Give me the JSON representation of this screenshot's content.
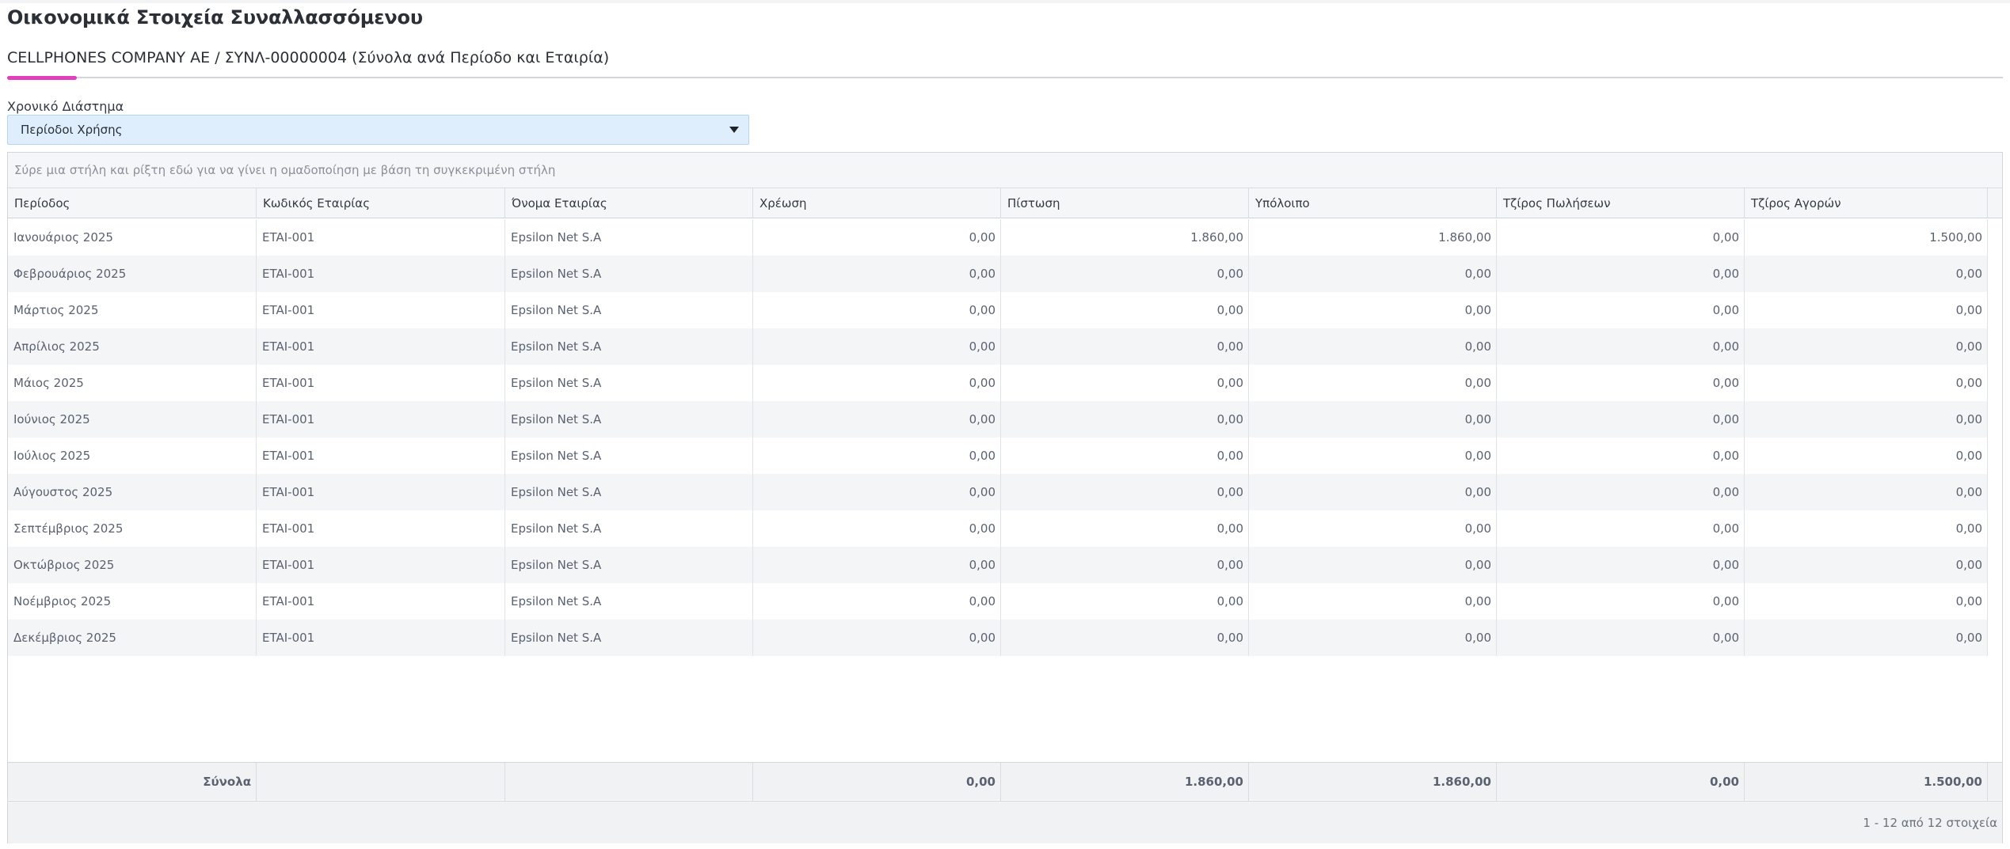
{
  "page": {
    "title": "Οικονομικά Στοιχεία Συναλλασσόμενου",
    "subtitle": "CELLPHONES COMPANY AE / ΣΥΝΛ-00000004 (Σύνολα ανά Περίοδο και Εταιρία)"
  },
  "filter": {
    "label": "Χρονικό Διάστημα",
    "selected": "Περίοδοι Χρήσης"
  },
  "grid": {
    "group_panel_text": "Σύρε μια στήλη και ρίξτη εδώ για να γίνει η ομαδοποίηση με βάση τη συγκεκριμένη στήλη",
    "columns": [
      "Περίοδος",
      "Κωδικός Εταιρίας",
      "Όνομα Εταιρίας",
      "Χρέωση",
      "Πίστωση",
      "Υπόλοιπο",
      "Τζίρος Πωλήσεων",
      "Τζίρος Αγορών"
    ],
    "rows": [
      [
        "Ιανουάριος 2025",
        "ETAI-001",
        "Epsilon Net S.A",
        "0,00",
        "1.860,00",
        "1.860,00",
        "0,00",
        "1.500,00"
      ],
      [
        "Φεβρουάριος 2025",
        "ETAI-001",
        "Epsilon Net S.A",
        "0,00",
        "0,00",
        "0,00",
        "0,00",
        "0,00"
      ],
      [
        "Μάρτιος 2025",
        "ETAI-001",
        "Epsilon Net S.A",
        "0,00",
        "0,00",
        "0,00",
        "0,00",
        "0,00"
      ],
      [
        "Απρίλιος 2025",
        "ETAI-001",
        "Epsilon Net S.A",
        "0,00",
        "0,00",
        "0,00",
        "0,00",
        "0,00"
      ],
      [
        "Μάιος 2025",
        "ETAI-001",
        "Epsilon Net S.A",
        "0,00",
        "0,00",
        "0,00",
        "0,00",
        "0,00"
      ],
      [
        "Ιούνιος 2025",
        "ETAI-001",
        "Epsilon Net S.A",
        "0,00",
        "0,00",
        "0,00",
        "0,00",
        "0,00"
      ],
      [
        "Ιούλιος 2025",
        "ETAI-001",
        "Epsilon Net S.A",
        "0,00",
        "0,00",
        "0,00",
        "0,00",
        "0,00"
      ],
      [
        "Αύγουστος 2025",
        "ETAI-001",
        "Epsilon Net S.A",
        "0,00",
        "0,00",
        "0,00",
        "0,00",
        "0,00"
      ],
      [
        "Σεπτέμβριος 2025",
        "ETAI-001",
        "Epsilon Net S.A",
        "0,00",
        "0,00",
        "0,00",
        "0,00",
        "0,00"
      ],
      [
        "Οκτώβριος 2025",
        "ETAI-001",
        "Epsilon Net S.A",
        "0,00",
        "0,00",
        "0,00",
        "0,00",
        "0,00"
      ],
      [
        "Νοέμβριος 2025",
        "ETAI-001",
        "Epsilon Net S.A",
        "0,00",
        "0,00",
        "0,00",
        "0,00",
        "0,00"
      ],
      [
        "Δεκέμβριος 2025",
        "ETAI-001",
        "Epsilon Net S.A",
        "0,00",
        "0,00",
        "0,00",
        "0,00",
        "0,00"
      ]
    ],
    "totals": [
      "Σύνολα",
      "",
      "",
      "0,00",
      "1.860,00",
      "1.860,00",
      "0,00",
      "1.500,00"
    ],
    "pager_text": "1 - 12 από 12 στοιχεία"
  },
  "colors": {
    "accent": "#e23fbf",
    "select_bg": "#deeefc"
  }
}
